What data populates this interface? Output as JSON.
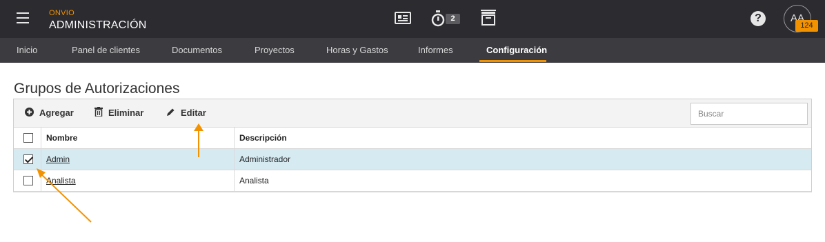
{
  "header": {
    "brand_small": "ONVIO",
    "brand_title": "ADMINISTRACIÓN",
    "timer_count": "2",
    "help_label": "?",
    "avatar_initials": "AA",
    "notification_count": "124",
    "accent_color": "#f39200",
    "icons": [
      "menu-icon",
      "contact-card-icon",
      "stopwatch-icon",
      "archive-icon",
      "help-icon"
    ]
  },
  "nav": {
    "items": [
      {
        "label": "Inicio"
      },
      {
        "label": "Panel de clientes"
      },
      {
        "label": "Documentos"
      },
      {
        "label": "Proyectos"
      },
      {
        "label": "Horas y Gastos"
      },
      {
        "label": "Informes"
      },
      {
        "label": "Configuración",
        "active": true
      }
    ]
  },
  "page": {
    "title": "Grupos de Autorizaciones"
  },
  "toolbar": {
    "add_label": "Agregar",
    "delete_label": "Eliminar",
    "edit_label": "Editar",
    "search_placeholder": "Buscar"
  },
  "table": {
    "columns": [
      "Nombre",
      "Descripción"
    ],
    "rows": [
      {
        "name": "Admin",
        "description": "Administrador",
        "checked": true,
        "selected": true
      },
      {
        "name": "Analista",
        "description": "Analista",
        "checked": false,
        "selected": false
      }
    ]
  }
}
